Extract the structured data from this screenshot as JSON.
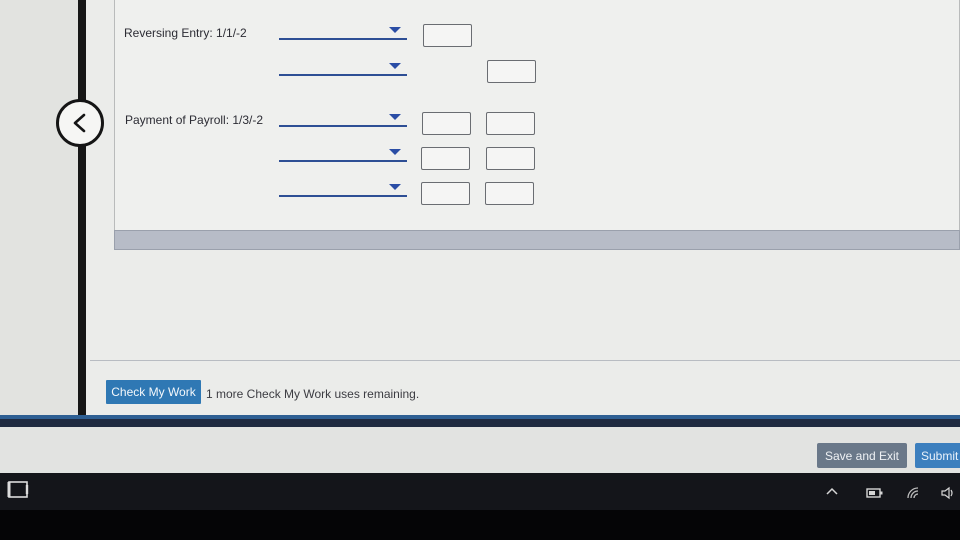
{
  "journal": {
    "rows": [
      {
        "label": "Reversing Entry: 1/1/-2",
        "lines": [
          {
            "account": "",
            "debit": "",
            "credit": null
          },
          {
            "account": "",
            "debit": null,
            "credit": ""
          }
        ]
      },
      {
        "label": "Payment of Payroll: 1/3/-2",
        "lines": [
          {
            "account": "",
            "debit": "",
            "credit": ""
          },
          {
            "account": "",
            "debit": "",
            "credit": ""
          },
          {
            "account": "",
            "debit": "",
            "credit": ""
          }
        ]
      }
    ]
  },
  "check": {
    "button_label": "Check My Work",
    "remaining_text": "1 more Check My Work uses remaining."
  },
  "footer": {
    "save_label": "Save and Exit",
    "submit_label": "Submit"
  },
  "icons": {
    "back": "chevron-left-icon",
    "tablet_mode": "tablet-mode-icon",
    "tray_expand": "chevron-up-icon",
    "battery": "battery-icon",
    "wifi": "wifi-icon",
    "volume": "volume-icon"
  },
  "colors": {
    "check_button": "#2f78b4",
    "save_button": "#6a7889",
    "submit_button": "#3c7fbe",
    "select_underline": "#2e4f95",
    "taskbar": "#14151a"
  }
}
